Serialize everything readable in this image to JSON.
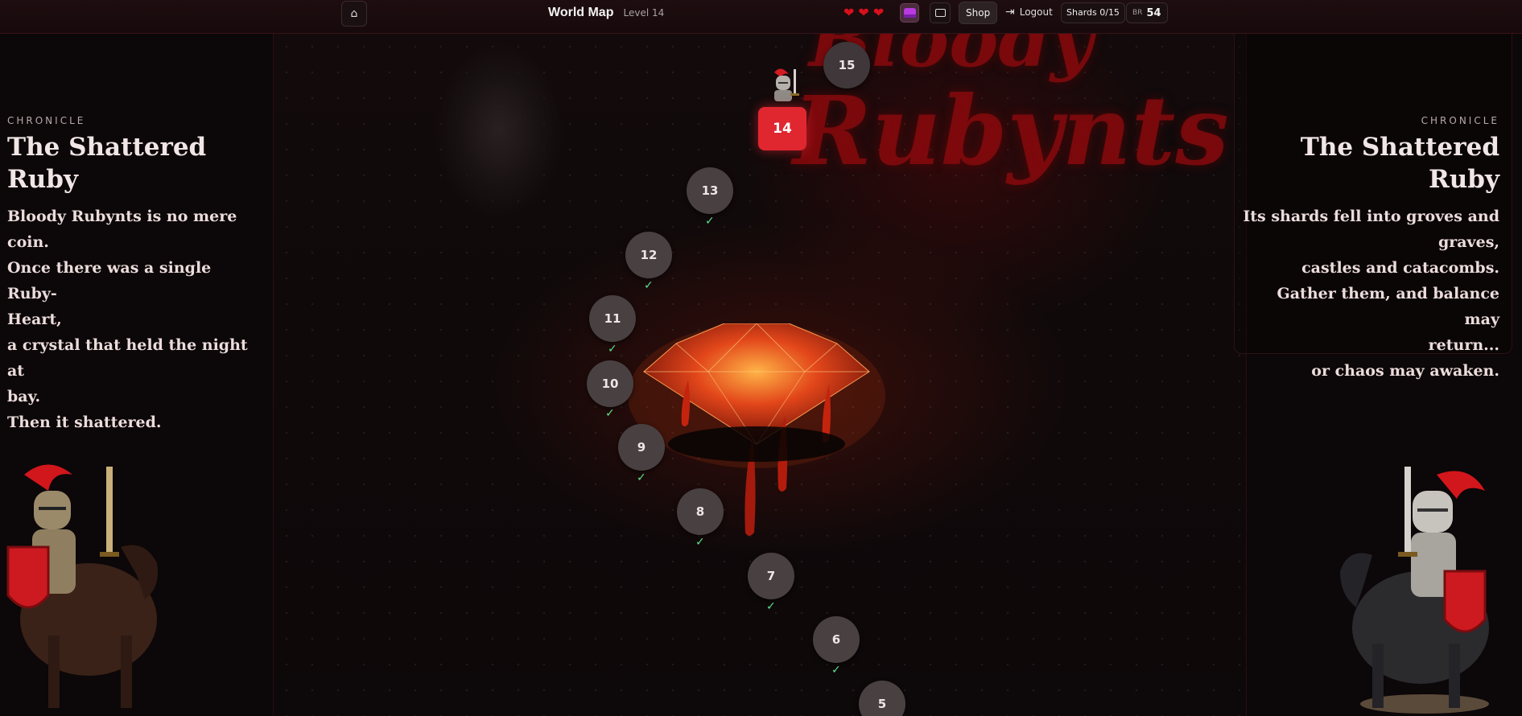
{
  "header": {
    "home_icon": "⌂",
    "title": "World Map",
    "level_label": "Level 14",
    "hearts": [
      "❤",
      "❤",
      "❤"
    ],
    "shop_label": "Shop",
    "logout_label": "Logout",
    "shards_label": "Shards 0/15",
    "br_label": "BR",
    "br_value": "54"
  },
  "map": {
    "logo_line1": "Bloody",
    "logo_line2": "Rubynts",
    "current_level": "14",
    "nodes": [
      {
        "label": "15",
        "status": "locked"
      },
      {
        "label": "14",
        "status": "current"
      },
      {
        "label": "13",
        "status": "completed"
      },
      {
        "label": "12",
        "status": "completed"
      },
      {
        "label": "11",
        "status": "completed"
      },
      {
        "label": "10",
        "status": "completed"
      },
      {
        "label": "9",
        "status": "completed"
      },
      {
        "label": "8",
        "status": "completed"
      },
      {
        "label": "7",
        "status": "completed"
      },
      {
        "label": "6",
        "status": "completed"
      },
      {
        "label": "5",
        "status": "completed"
      }
    ],
    "check_mark": "✓"
  },
  "left_panel": {
    "label": "CHRONICLE",
    "title": "The Shattered Ruby",
    "lines": [
      "Bloody Rubynts is no mere coin.",
      "Once there was a single Ruby-",
      "Heart,",
      "a crystal that held the night at",
      "bay.",
      "Then it shattered."
    ]
  },
  "right_panel": {
    "label": "CHRONICLE",
    "title": "The Shattered Ruby",
    "lines": [
      "Its shards fell into groves and",
      "graves,",
      "castles and catacombs.",
      "Gather them, and balance may",
      "return...",
      "or chaos may awaken."
    ]
  },
  "colors": {
    "accent": "#e02730",
    "check": "#5ee08a",
    "heart": "#d8101c",
    "background": "#0c0708"
  },
  "icons": {
    "home": "home-icon",
    "chest": "treasure-chest-icon",
    "wallet": "wallet-icon",
    "logout": "logout-icon",
    "heart": "heart-icon"
  }
}
